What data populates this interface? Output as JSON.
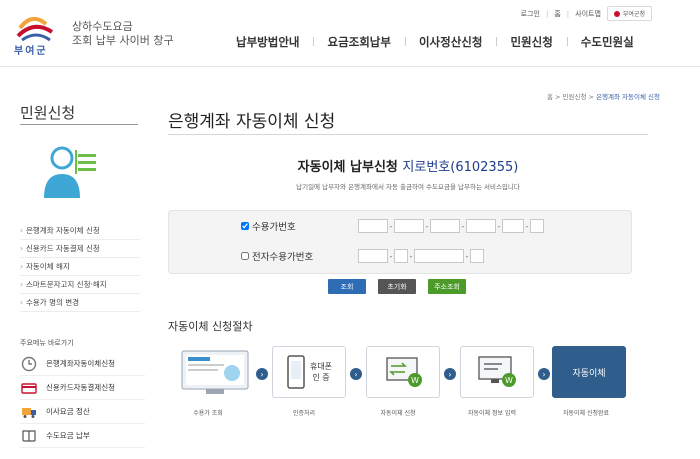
{
  "topbar": {
    "login": "로그인",
    "home": "홈",
    "sitemap": "사이트맵",
    "lang": "부여군청"
  },
  "logo_text": "부여군",
  "site_title": [
    "상하수도요금",
    "조회 납부 사이버 창구"
  ],
  "gnb": [
    "납부방법안내",
    "요금조회납부",
    "이사정산신청",
    "민원신청",
    "수도민원실"
  ],
  "sidebar": {
    "title": "민원신청",
    "menu": [
      "은행계좌 자동이체 신청",
      "신용카드 자동결제 신청",
      "자동이체 해지",
      "스마트문자고지 신청·해지",
      "수용가 명의 변경"
    ],
    "quick_title": "주요메뉴 바로가기",
    "quick": [
      {
        "label": "은행계좌자동이체신청",
        "icon": "clock-icon"
      },
      {
        "label": "신용카드자동결제신청",
        "icon": "card-icon"
      },
      {
        "label": "이사요금 정산",
        "icon": "truck-icon"
      },
      {
        "label": "수도요금 납부",
        "icon": "book-icon"
      }
    ]
  },
  "breadcrumb": {
    "home": "홈",
    "sep1": " > ",
    "parent": "민원신청",
    "sep2": " > ",
    "current": "은행계좌 자동이체 신청"
  },
  "page_title": "은행계좌 자동이체 신청",
  "subhead": {
    "main": "자동이체 납부신청",
    "giro": "지로번호(6102355)"
  },
  "desc": "납기일에 납부자와 은행계좌에서 자동 출금하여 수도요금을 납부하는 서비스입니다",
  "form": {
    "row1": {
      "label": "수용가번호",
      "checked": true
    },
    "row2": {
      "label": "전자수용가번호",
      "checked": false
    }
  },
  "buttons": {
    "search": "조회",
    "reset": "초기화",
    "address": "주소조회"
  },
  "process": {
    "title": "자동이체 신청절차",
    "step2_text": [
      "휴대폰",
      "인 증"
    ],
    "step5_text": "자동이체",
    "labels": [
      "수용가 조회",
      "인증처리",
      "자동이체 신청",
      "자동이체 정보 입력",
      "자동이체 신청완료"
    ]
  },
  "colors": {
    "brand": "#1e3c8c",
    "btn_blue": "#2e6db4",
    "btn_dark": "#555555",
    "btn_green": "#4c9a2a",
    "step_active": "#2f5d8c"
  }
}
